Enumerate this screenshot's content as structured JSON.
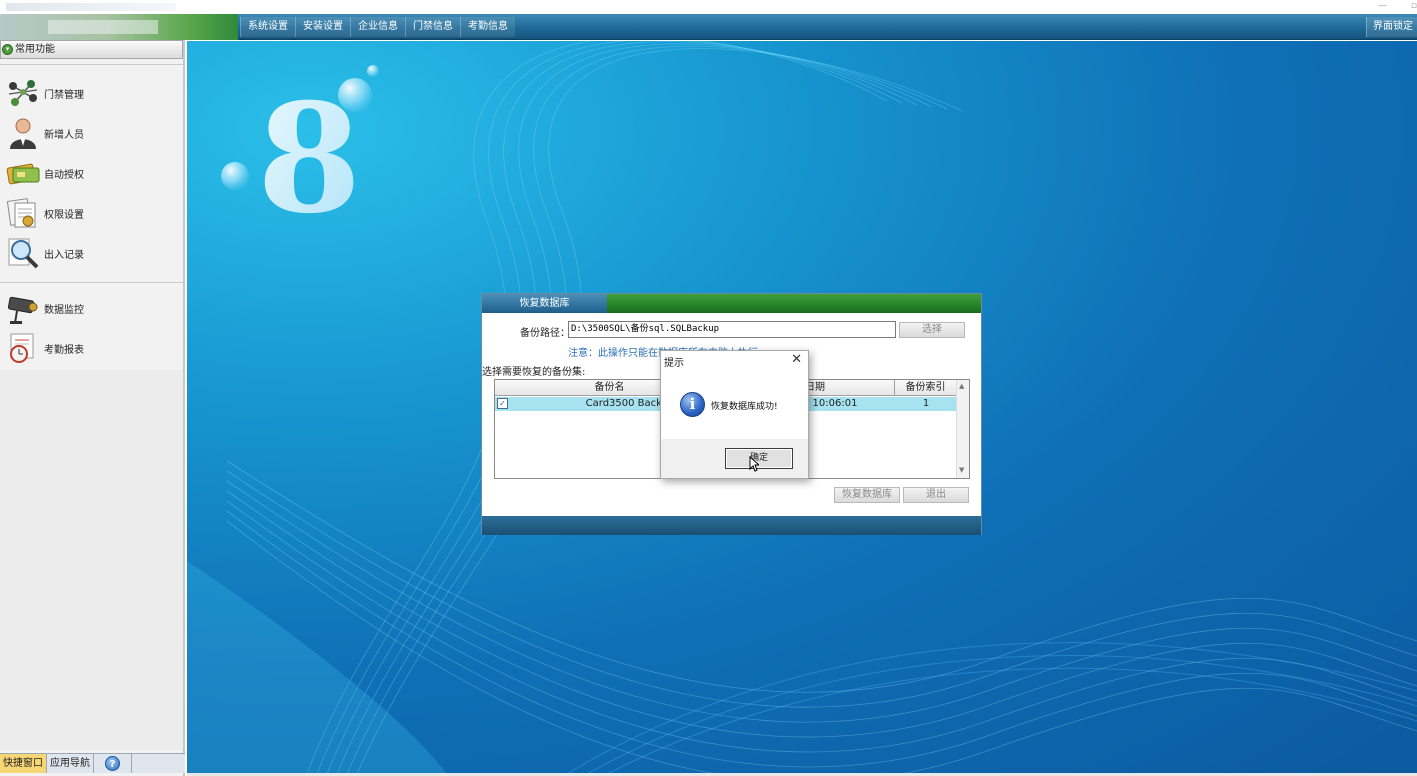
{
  "window": {
    "controls": {
      "minimize": "—",
      "restore": "▫"
    }
  },
  "menubar": {
    "items": [
      {
        "label": "系统设置"
      },
      {
        "label": "安装设置"
      },
      {
        "label": "企业信息"
      },
      {
        "label": "门禁信息"
      },
      {
        "label": "考勤信息"
      }
    ],
    "lock_label": "界面锁定"
  },
  "sidebar": {
    "header": "常用功能",
    "items": [
      {
        "label": "门禁管理",
        "icon": "network-icon"
      },
      {
        "label": "新增人员",
        "icon": "person-icon"
      },
      {
        "label": "自动授权",
        "icon": "card-icon"
      },
      {
        "label": "权限设置",
        "icon": "documents-icon"
      },
      {
        "label": "出入记录",
        "icon": "magnifier-icon"
      },
      {
        "label": "数据监控",
        "icon": "camera-icon"
      },
      {
        "label": "考勤报表",
        "icon": "clock-icon"
      }
    ],
    "bottom_tabs": [
      {
        "label": "快捷窗口"
      },
      {
        "label": "应用导航"
      },
      {
        "label": "?"
      }
    ]
  },
  "restore_dialog": {
    "title": "恢复数据库",
    "path_label": "备份路径：",
    "path_value": "D:\\3500SQL\\备份sql.SQLBackup",
    "choose_button": "选择",
    "note": "注意：此操作只能在数据库所在电脑上执行。",
    "select_label": "选择需要恢复的备份集:",
    "columns": [
      "备份名",
      "日期",
      "备份索引"
    ],
    "rows": [
      {
        "checked": "✓",
        "name": "Card3500 Backup",
        "date": "10:06:01",
        "index": "1"
      }
    ],
    "restore_button": "恢复数据库",
    "exit_button": "退出"
  },
  "message_box": {
    "title": "提示",
    "close": "✕",
    "text": "恢复数据库成功!",
    "ok_button": "确定"
  },
  "colors": {
    "menubar": "#1f6a98",
    "dialog_title_green": "#237d25",
    "row_highlight": "#a6e2f0",
    "desktop_blue": "#0f6fb6"
  }
}
